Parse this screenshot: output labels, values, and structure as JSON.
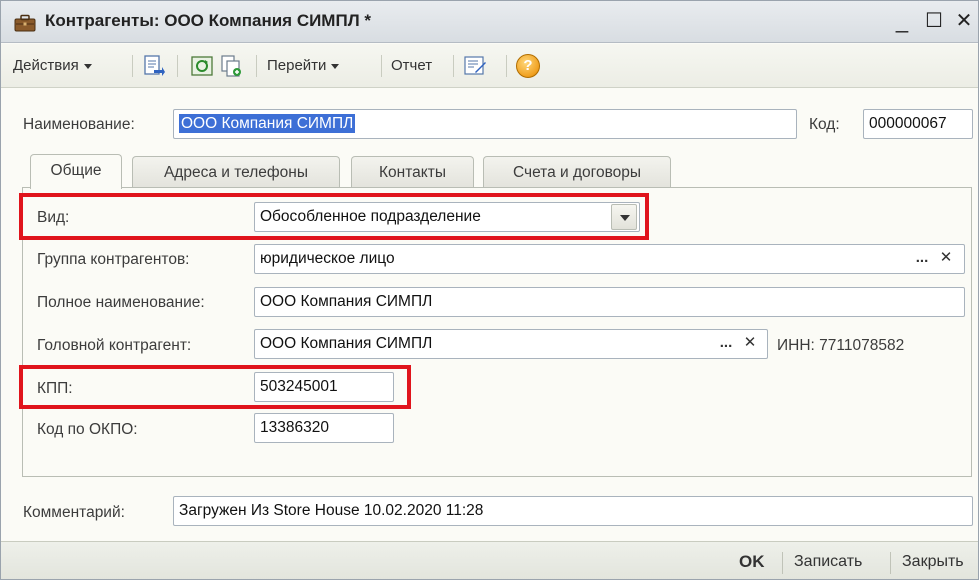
{
  "window": {
    "title": "Контрагенты: ООО Компания СИМПЛ *",
    "minimize_symbol": "_",
    "maximize_symbol": "☐",
    "close_symbol": "✕"
  },
  "toolbar": {
    "actions_label": "Действия",
    "goto_label": "Перейти",
    "report_label": "Отчет",
    "help_symbol": "?"
  },
  "header": {
    "name_label": "Наименование:",
    "name_value": "ООО Компания СИМПЛ",
    "code_label": "Код:",
    "code_value": "000000067"
  },
  "tabs": [
    {
      "label": "Общие",
      "active": true
    },
    {
      "label": "Адреса и телефоны",
      "active": false
    },
    {
      "label": "Контакты",
      "active": false
    },
    {
      "label": "Счета и договоры",
      "active": false
    }
  ],
  "general": {
    "kind_label": "Вид:",
    "kind_value": "Обособленное подразделение",
    "group_label": "Группа контрагентов:",
    "group_value": "юридическое лицо",
    "fullname_label": "Полное наименование:",
    "fullname_value": "ООО Компания СИМПЛ",
    "parent_label": "Головной контрагент:",
    "parent_value": "ООО Компания СИМПЛ",
    "inn_text": "ИНН: 7711078582",
    "kpp_label": "КПП:",
    "kpp_value": "503245001",
    "okpo_label": "Код по ОКПО:",
    "okpo_value": "13386320",
    "select_symbol": "...",
    "clear_symbol": "✕"
  },
  "comment": {
    "label": "Комментарий:",
    "value": "Загружен Из Store House 10.02.2020 11:28"
  },
  "footer": {
    "ok_label": "OK",
    "save_label": "Записать",
    "close_label": "Закрыть"
  },
  "colors": {
    "highlight": "#e0141c",
    "selection": "#3d6fd6",
    "help_icon": "#f0a020"
  }
}
